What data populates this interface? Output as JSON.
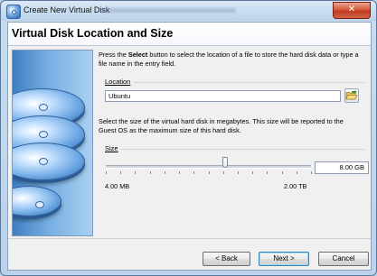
{
  "window": {
    "title": "Create New Virtual Disk",
    "close_glyph": "✕"
  },
  "page": {
    "heading": "Virtual Disk Location and Size"
  },
  "location": {
    "intro_before": "Press the ",
    "intro_bold": "Select",
    "intro_after": " button to select the location of a file to store the hard disk data or type a file name in the entry field.",
    "group_label": "Location",
    "value": "Ubuntu",
    "select_icon": "folder-open-icon"
  },
  "size": {
    "intro": "Select the size of the virtual hard disk in megabytes. This size will be reported to the Guest OS as the maximum size of this hard disk.",
    "group_label": "Size",
    "value": "8.00 GB",
    "min_label": "4.00 MB",
    "max_label": "2.00 TB",
    "slider_fraction": 0.58
  },
  "buttons": {
    "back": "< Back",
    "next": "Next >",
    "cancel": "Cancel"
  },
  "colors": {
    "title_bar": "#c6daf0",
    "close_button": "#c8462a",
    "side_panel": "#5d9ad6",
    "default_button_border": "#3c7fb1"
  }
}
